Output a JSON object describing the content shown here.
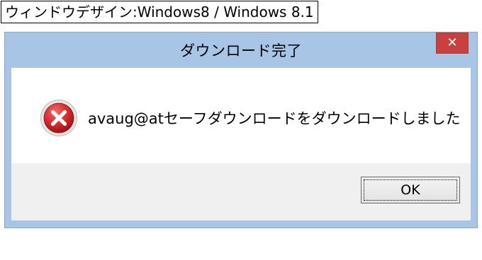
{
  "caption": {
    "text": "ウィンドウデザイン:Windows8 / Windows 8.1"
  },
  "dialog": {
    "title": "ダウンロード完了",
    "close_glyph": "✕",
    "message": "avaug@atセーフダウンロードをダウンロードしました",
    "icon": "error-icon",
    "ok_label": "OK"
  },
  "colors": {
    "frame": "#a9c5e6",
    "close_button": "#c7423e",
    "content_bg": "#ffffff",
    "footer_bg": "#f0f0f0",
    "error_red": "#d42a2a"
  }
}
